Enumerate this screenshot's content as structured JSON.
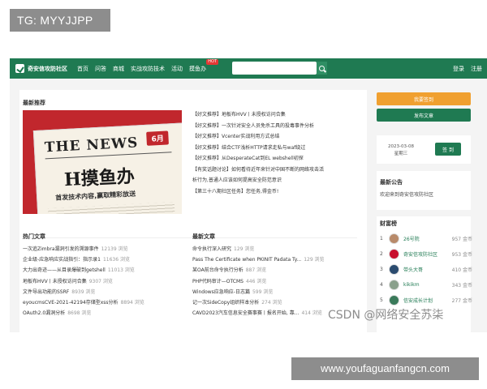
{
  "tg_label": "TG: MYYJJPP",
  "url_label": "www.youfaguanfangcn.com",
  "watermark": "CSDN @网络安全苏柒",
  "site": {
    "logo_text": "奇安信攻防社区",
    "nav": [
      "首页",
      "问答",
      "商城",
      "实战攻防技术",
      "活动",
      "摸鱼办"
    ],
    "hot_badge": "HOT",
    "auth": [
      "登录",
      "注册"
    ]
  },
  "latest": {
    "title": "最新推荐",
    "feature_image": {
      "masthead": "THE NEWS",
      "issue": "6月",
      "headline": "H摸鱼办",
      "subline": "首发技术内容,赢取精彩放送"
    },
    "items": [
      "【好文推荐】地板布HVV丨未授权访问合集",
      "【好文推荐】一次针对安全人员免杀工具的投毒事件分析",
      "【好文推荐】Vcenter实战利用方式总结",
      "【好文推荐】结合CTF浅析HTTP请求走私与waf绕过",
      "【好文推荐】从DesperateCat到EL webshell初探",
      "【有奖话题讨论】如何看待近年来针对中国不断的网络攻击活",
      "析行为,普通人应该如何提高安全防范意识",
      "【第三十八期社区任务】您任务,得金币!"
    ]
  },
  "hot": {
    "title": "热门文章",
    "items": [
      {
        "text": "一次追Zimbra漏洞引发的溯源事件",
        "views": "12139 浏览"
      },
      {
        "text": "企业级-应急响应实战指引：指示录1",
        "views": "11636 浏览"
      },
      {
        "text": "大力出奇迹——从目录爆破到getshell",
        "views": "11013 浏览"
      },
      {
        "text": "地板布HVV丨未授权访问合集",
        "views": "9307 浏览"
      },
      {
        "text": "文件导出功能的SSRF",
        "views": "8939 浏览"
      },
      {
        "text": "eyoucmsCVE-2021-42194存储型xss分析",
        "views": "8894 浏览"
      },
      {
        "text": "OAuth2.0漏洞分析",
        "views": "8698 浏览"
      }
    ]
  },
  "newest": {
    "title": "最新文章",
    "items": [
      {
        "text": "命令执行深入研究",
        "views": "129 浏览"
      },
      {
        "text": "Pass The Certificate when PKINIT Padata Ty...",
        "views": "129 浏览"
      },
      {
        "text": "某OA前台命令执行分析",
        "views": "887 浏览"
      },
      {
        "text": "PHP代码审计—OTCMS",
        "views": "446 浏览"
      },
      {
        "text": "Windows应急响应-日志篇",
        "views": "599 浏览"
      },
      {
        "text": "记一次SideCopy组织样本分析",
        "views": "274 浏览"
      },
      {
        "text": "CAVD2023汽车信息安全赛事赛丨报名开始, 靠...",
        "views": "414 浏览"
      }
    ]
  },
  "sidebar": {
    "sign_button": "我要签到",
    "post_button": "发布文章",
    "date": "2023-03-08",
    "weekday": "星期三",
    "checkin_button": "签 到",
    "notice_title": "最新公告",
    "notice_text": "欢迎来到奇安信攻防社区",
    "rich_title": "财富榜",
    "rich": [
      {
        "rank": "1",
        "name": "26号院",
        "coins": "957 金币",
        "avatar_color": "#b88a6a"
      },
      {
        "rank": "2",
        "name": "奇安信攻防社区",
        "coins": "953 金币",
        "avatar_color": "#c8102e"
      },
      {
        "rank": "3",
        "name": "带头大哥",
        "coins": "410 金币",
        "avatar_color": "#2b4b6f"
      },
      {
        "rank": "4",
        "name": "kikikm",
        "coins": "343 金币",
        "avatar_color": "#8aa08c"
      },
      {
        "rank": "5",
        "name": "信安成长计划",
        "coins": "277 金币",
        "avatar_color": "#3a7a5a"
      }
    ]
  }
}
